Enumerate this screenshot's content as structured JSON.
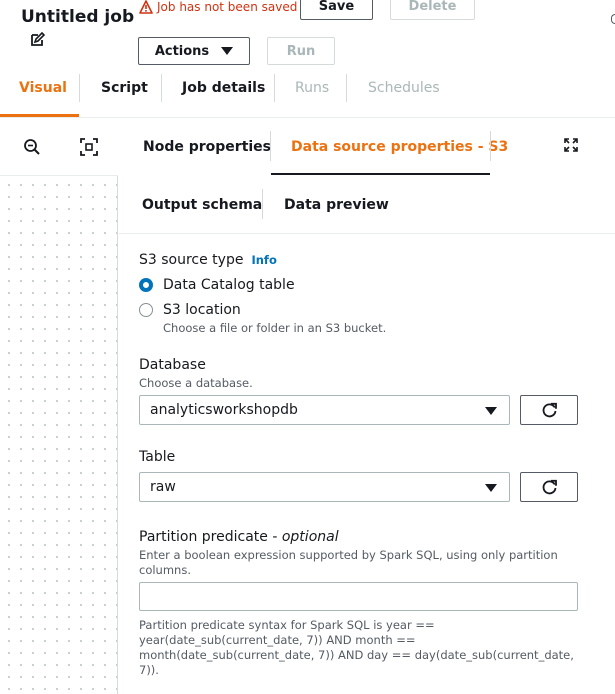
{
  "header": {
    "job_title": "Untitled job",
    "unsaved_warning": "Job has not been saved",
    "save_label": "Save",
    "delete_label": "Delete",
    "actions_label": "Actions",
    "run_label": "Run"
  },
  "tabs": [
    {
      "label": "Visual",
      "state": "active"
    },
    {
      "label": "Script",
      "state": "enabled"
    },
    {
      "label": "Job details",
      "state": "enabled"
    },
    {
      "label": "Runs",
      "state": "disabled"
    },
    {
      "label": "Schedules",
      "state": "disabled"
    }
  ],
  "canvas": {
    "icons": [
      "zoom-out-icon",
      "fit-to-screen-icon"
    ]
  },
  "panel": {
    "tabs": [
      {
        "label": "Node properties"
      },
      {
        "label": "Data source properties - S3",
        "state": "active"
      },
      {
        "label": "Output schema"
      },
      {
        "label": "Data preview"
      }
    ],
    "s3_source_type": {
      "label": "S3 source type",
      "info": "Info",
      "options": [
        {
          "label": "Data Catalog table",
          "checked": true
        },
        {
          "label": "S3 location",
          "description": "Choose a file or folder in an S3 bucket.",
          "checked": false
        }
      ]
    },
    "database": {
      "label": "Database",
      "description": "Choose a database.",
      "value": "analyticsworkshopdb"
    },
    "table": {
      "label": "Table",
      "value": "raw"
    },
    "partition_predicate": {
      "label": "Partition predicate - ",
      "optional": "optional",
      "description": "Enter a boolean expression supported by Spark SQL, using only partition columns.",
      "value": "",
      "hint": "Partition predicate syntax for Spark SQL is year == year(date_sub(current_date, 7)) AND month == month(date_sub(current_date, 7)) AND day == day(date_sub(current_date, 7))."
    }
  },
  "colors": {
    "accent": "#ec7211",
    "link": "#0073bb",
    "warning": "#d13212",
    "radio_checked": "#0073bb",
    "disabled": "#aab7b8"
  }
}
